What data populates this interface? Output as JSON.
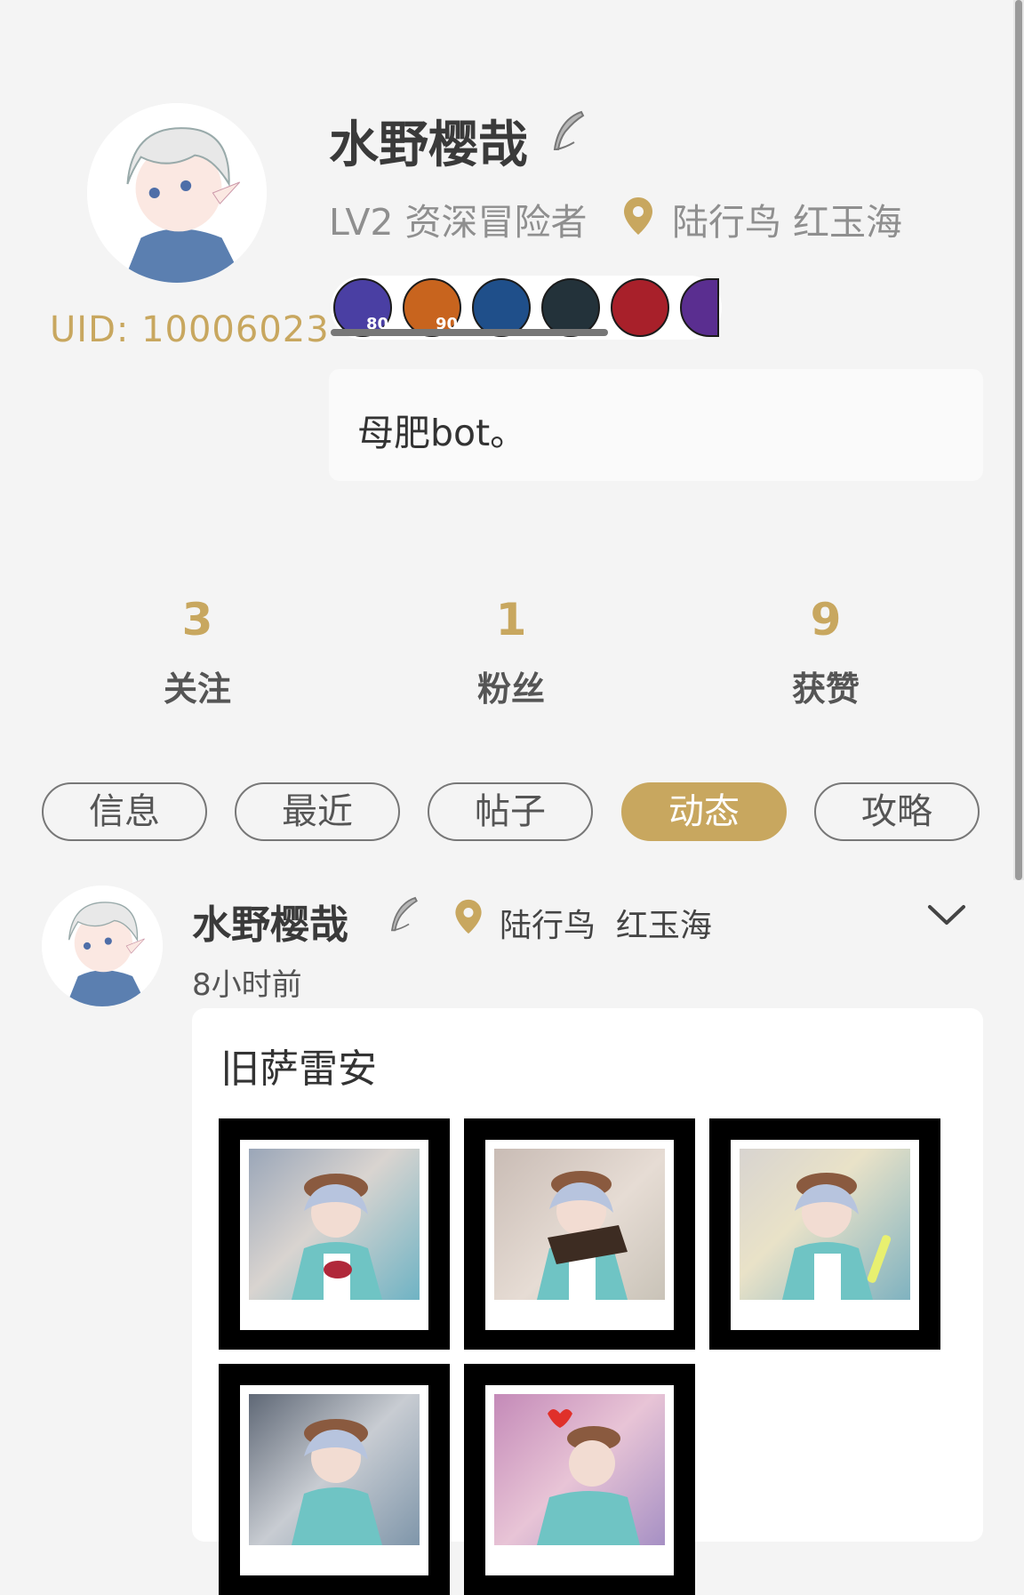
{
  "profile": {
    "name": "水野樱哉",
    "level": "LV2 资深冒险者",
    "location": "陆行鸟 红玉海",
    "uid": "UID: 10006023",
    "bio": "母肥bot。",
    "badges": [
      {
        "icon": "blacksmith-job-icon",
        "level": "80",
        "color": "#4a3fa3"
      },
      {
        "icon": "fisher-job-icon",
        "level": "90",
        "color": "#c8641e"
      },
      {
        "icon": "crystal-crest-icon",
        "color": "#1f4f8a"
      },
      {
        "icon": "dragon-crest-icon",
        "color": "#23323a"
      },
      {
        "icon": "red-banner-icon",
        "color": "#a8202a"
      },
      {
        "icon": "purple-job-icon",
        "color": "#5a2e90"
      }
    ]
  },
  "stats": [
    {
      "value": "3",
      "label": "关注"
    },
    {
      "value": "1",
      "label": "粉丝"
    },
    {
      "value": "9",
      "label": "获赞"
    }
  ],
  "tabs": [
    {
      "label": "信息",
      "active": false
    },
    {
      "label": "最近",
      "active": false
    },
    {
      "label": "帖子",
      "active": false
    },
    {
      "label": "动态",
      "active": true
    },
    {
      "label": "攻略",
      "active": false
    }
  ],
  "post": {
    "author": "水野樱哉",
    "location": "陆行鸟  红玉海",
    "time": "8小时前",
    "title": "旧萨雷安",
    "photo_count": 5
  },
  "colors": {
    "accent": "#c8a75f",
    "background": "#f4f4f4"
  }
}
